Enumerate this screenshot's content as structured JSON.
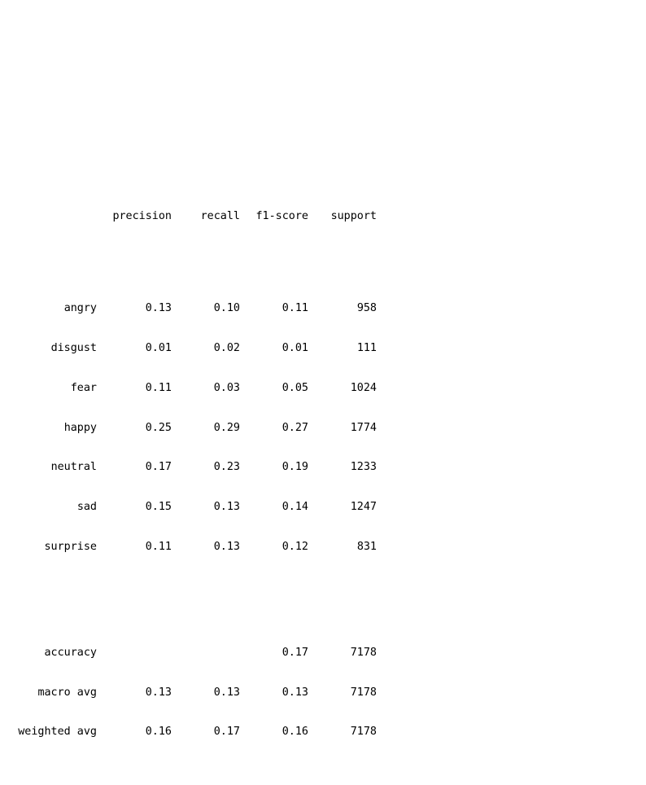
{
  "report": {
    "headers": [
      "precision",
      "recall",
      "f1-score",
      "support"
    ],
    "classes": [
      {
        "label": "angry",
        "precision": "0.13",
        "recall": "0.10",
        "f1": "0.11",
        "support": "958"
      },
      {
        "label": "disgust",
        "precision": "0.01",
        "recall": "0.02",
        "f1": "0.01",
        "support": "111"
      },
      {
        "label": "fear",
        "precision": "0.11",
        "recall": "0.03",
        "f1": "0.05",
        "support": "1024"
      },
      {
        "label": "happy",
        "precision": "0.25",
        "recall": "0.29",
        "f1": "0.27",
        "support": "1774"
      },
      {
        "label": "neutral",
        "precision": "0.17",
        "recall": "0.23",
        "f1": "0.19",
        "support": "1233"
      },
      {
        "label": "sad",
        "precision": "0.15",
        "recall": "0.13",
        "f1": "0.14",
        "support": "1247"
      },
      {
        "label": "surprise",
        "precision": "0.11",
        "recall": "0.13",
        "f1": "0.12",
        "support": "831"
      }
    ],
    "summary": [
      {
        "label": "accuracy",
        "precision": "",
        "recall": "",
        "f1": "0.17",
        "support": "7178"
      },
      {
        "label": "macro avg",
        "precision": "0.13",
        "recall": "0.13",
        "f1": "0.13",
        "support": "7178"
      },
      {
        "label": "weighted avg",
        "precision": "0.16",
        "recall": "0.17",
        "f1": "0.16",
        "support": "7178"
      }
    ]
  }
}
